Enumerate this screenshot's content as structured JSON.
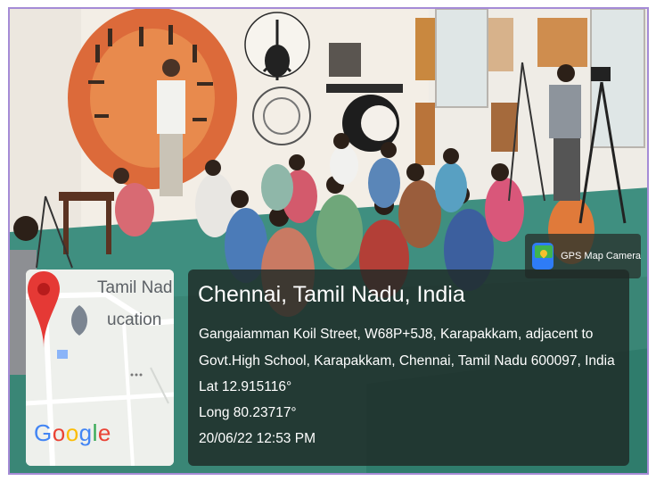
{
  "gps_badge": {
    "label": "GPS Map Camera",
    "icon": "gps-map-camera-app-icon"
  },
  "map": {
    "place_line1": "Tamil Nad",
    "place_line2": "ucation",
    "logo": "Google",
    "pin_icon": "map-pin-icon"
  },
  "location": {
    "title": "Chennai, Tamil Nadu, India",
    "address_line1": "Gangaiamman Koil Street, W68P+5J8, Karapakkam, adjacent to",
    "address_line2": "Govt.High School, Karapakkam, Chennai, Tamil Nadu 600097, India",
    "latitude": "Lat 12.915116°",
    "longitude": "Long 80.23717°",
    "timestamp": "20/06/22 12:53 PM"
  },
  "colors": {
    "frame_border": "#a58bd6",
    "panel_bg": "#1e2a26",
    "pin_red": "#e53935",
    "floor_green": "#3f8f80"
  }
}
